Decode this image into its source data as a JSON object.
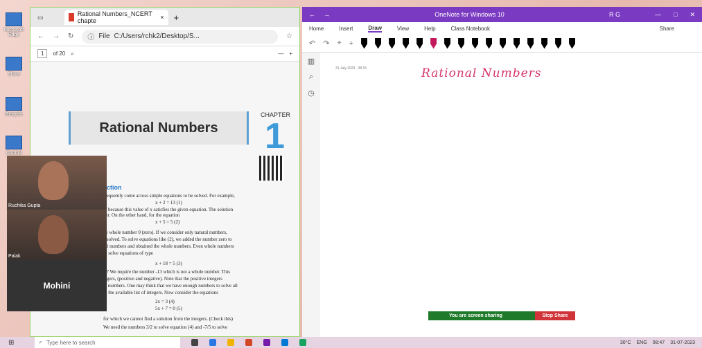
{
  "desktop": {
    "icons": [
      "Microsoft Edge",
      "Show",
      "Recycle",
      "Control"
    ]
  },
  "edge": {
    "tab_title": "Rational Numbers_NCERT chapte",
    "url_prefix": "File",
    "url": "C:/Users/rchk2/Desktop/S...",
    "page_num": "1",
    "page_total": "of 20"
  },
  "pdf": {
    "title": "Rational Numbers",
    "chapter_label": "CHAPTER",
    "chapter_num": "1",
    "section": "ction",
    "lines": [
      "frequently come across simple equations to be solved. For example,",
      "x + 2 = 13   (1)",
      "1, because this value of x satisfies the given equation. The solution",
      "ber. On the other hand, for the equation",
      "x + 5 = 5   (2)",
      "he whole number 0 (zero). If we consider only natural numbers,",
      "e solved. To solve equations like (2), we added the number zero to",
      "ral numbers and obtained the whole numbers. Even whole numbers",
      "to solve equations of type",
      "x + 18 = 5   (3)",
      "y'? We require the number -13 which is not a whole number. This",
      "tegers, (positive and negative). Note that the positive integers",
      "al numbers. One may think that we have enough numbers to solve all",
      "th the available list of integers. Now consider the equations",
      "2x = 3   (4)",
      "5x + 7 = 0   (5)",
      "for which we cannot find a solution from the integers. (Check this)",
      "We need the numbers 3/2 to solve equation (4) and -7/5 to solve"
    ]
  },
  "video": {
    "tile1": "Ruchika Gupta",
    "tile2": "Palak",
    "tile3": "Mohini"
  },
  "onenote": {
    "title": "OneNote for Windows 10",
    "user": "R G",
    "menu": [
      "Home",
      "Insert",
      "Draw",
      "View",
      "Help",
      "Class Notebook"
    ],
    "share": "Share",
    "date": "31 July 2023",
    "time": "08:15",
    "ink": "Rational   Numbers",
    "pen_colors": [
      "#000000",
      "#000000",
      "#000000",
      "#000000",
      "#000000",
      "#c2185b",
      "#000000",
      "#000000",
      "#000000",
      "#000000",
      "#000000",
      "#000000",
      "#000000",
      "#000000",
      "#000000",
      "#000000"
    ]
  },
  "sharing": {
    "message": "You are screen sharing",
    "stop": "Stop Share"
  },
  "taskbar": {
    "search": "Type here to search",
    "temp": "30°C",
    "lang": "ENG",
    "time": "08:47",
    "date": "31-07-2023"
  }
}
